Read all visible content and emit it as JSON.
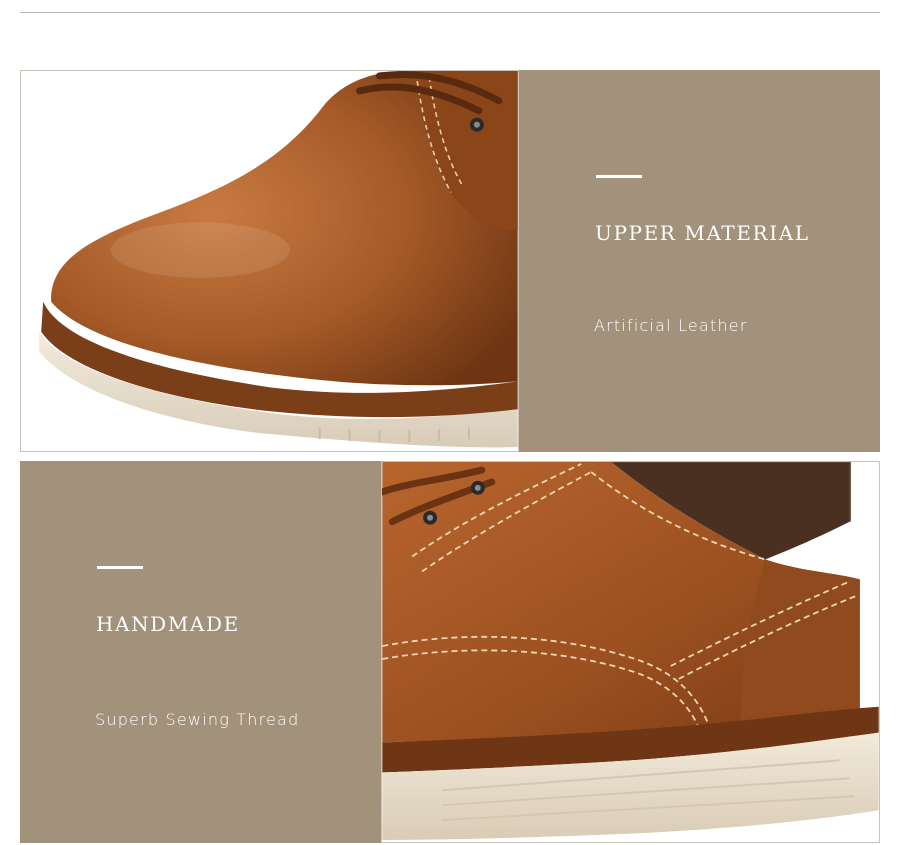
{
  "sections": [
    {
      "title": "UPPER MATERIAL",
      "subtitle": "Artificial Leather"
    },
    {
      "title": "HANDMADE",
      "subtitle": "Superb Sewing Thread"
    }
  ],
  "colors": {
    "panel": "#a3927b",
    "leather": "#a65a2a",
    "sole": "#eee3d0",
    "text": "#ffffff"
  },
  "images": [
    {
      "name": "shoe-toe-closeup-image"
    },
    {
      "name": "shoe-stitching-closeup-image"
    }
  ]
}
